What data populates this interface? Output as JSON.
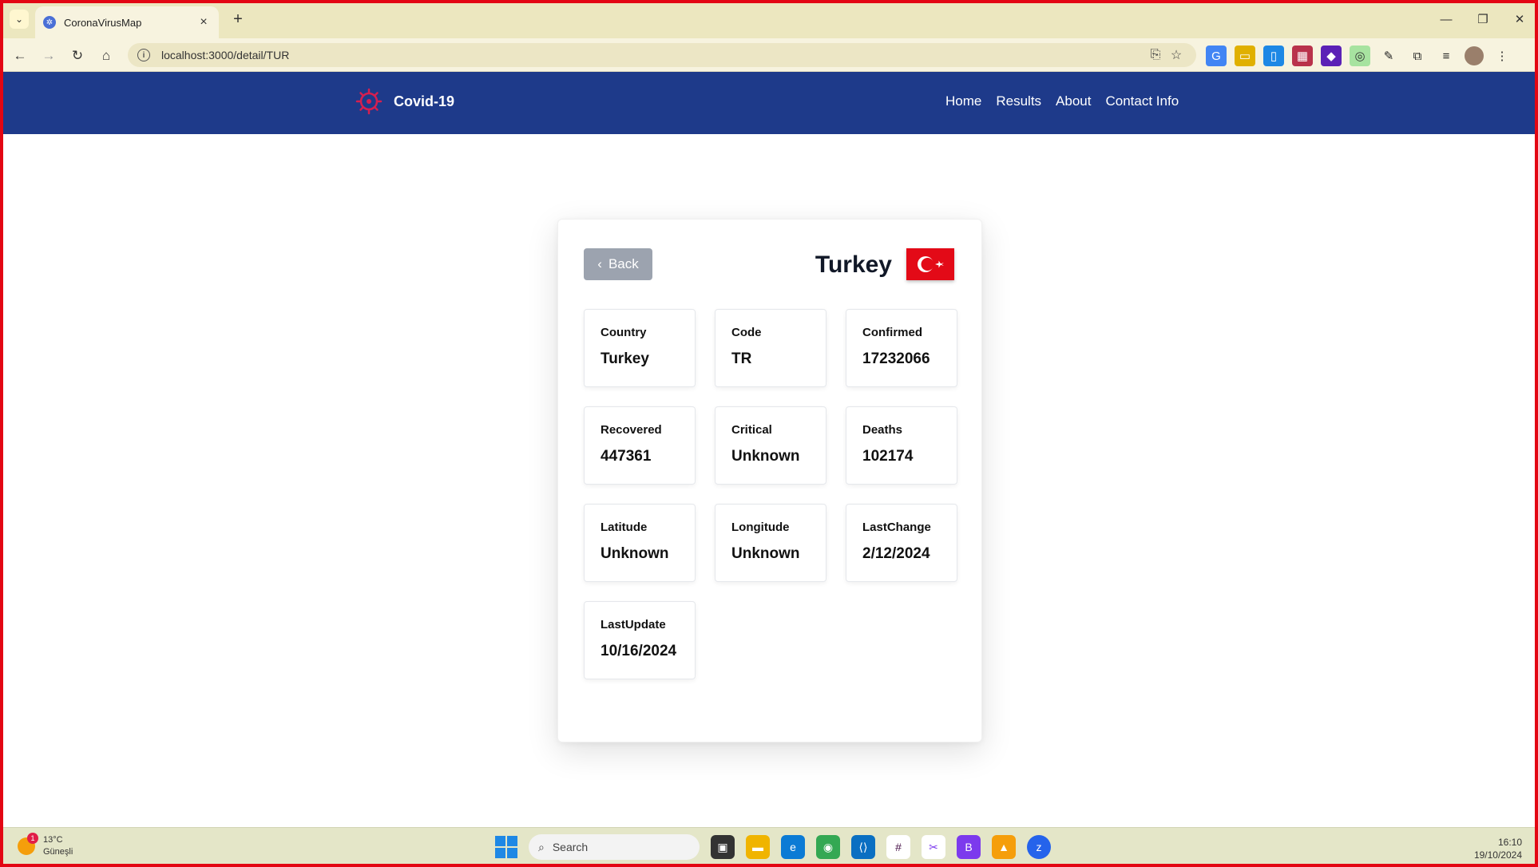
{
  "browser": {
    "tab_title": "CoronaVirusMap",
    "url": "localhost:3000/detail/TUR"
  },
  "app": {
    "brand": "Covid-19",
    "nav": [
      "Home",
      "Results",
      "About",
      "Contact Info"
    ],
    "back_label": "Back",
    "country_title": "Turkey",
    "stats": [
      {
        "label": "Country",
        "value": "Turkey"
      },
      {
        "label": "Code",
        "value": "TR"
      },
      {
        "label": "Confirmed",
        "value": "17232066"
      },
      {
        "label": "Recovered",
        "value": "447361"
      },
      {
        "label": "Critical",
        "value": "Unknown"
      },
      {
        "label": "Deaths",
        "value": "102174"
      },
      {
        "label": "Latitude",
        "value": "Unknown"
      },
      {
        "label": "Longitude",
        "value": "Unknown"
      },
      {
        "label": "LastChange",
        "value": "2/12/2024"
      },
      {
        "label": "LastUpdate",
        "value": "10/16/2024"
      }
    ],
    "colors": {
      "nav_bg": "#1e3a8a",
      "flag_red": "#e30a17",
      "back_bg": "#9ca3af"
    }
  },
  "taskbar": {
    "weather_temp": "13°C",
    "weather_desc": "Güneşli",
    "weather_badge": "1",
    "search_placeholder": "Search",
    "time": "16:10",
    "date": "19/10/2024"
  }
}
